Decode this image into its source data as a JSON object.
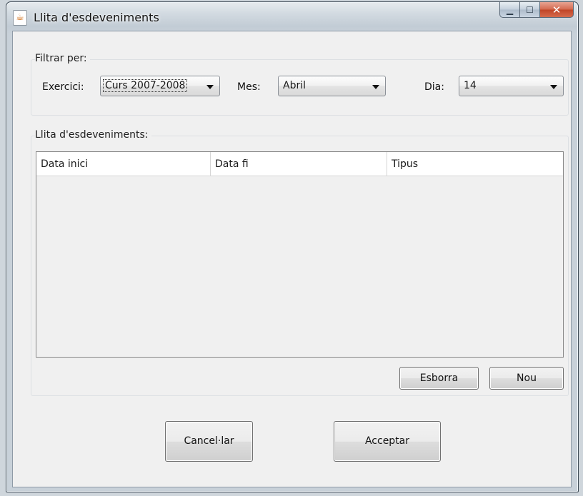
{
  "window": {
    "title": "Llita d'esdeveniments"
  },
  "filter": {
    "group_label": "Filtrar per:",
    "exercici": {
      "label": "Exercici:",
      "value": "Curs 2007-2008"
    },
    "mes": {
      "label": "Mes:",
      "value": "Abril"
    },
    "dia": {
      "label": "Dia:",
      "value": "14"
    }
  },
  "events": {
    "group_label": "Llita d'esdeveniments:",
    "columns": [
      "Data inici",
      "Data fi",
      "Tipus"
    ],
    "rows": [],
    "delete_label": "Esborra",
    "new_label": "Nou"
  },
  "footer": {
    "cancel_label": "Cancel·lar",
    "accept_label": "Acceptar"
  }
}
